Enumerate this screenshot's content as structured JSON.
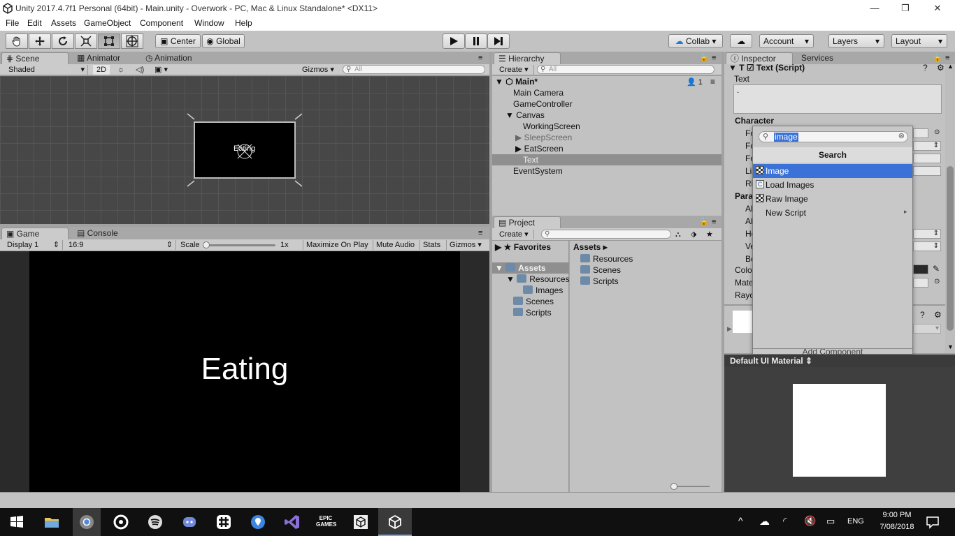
{
  "window": {
    "title": "Unity 2017.4.7f1 Personal (64bit) - Main.unity - Overwork - PC, Mac & Linux Standalone* <DX11>",
    "min_glyph": "—",
    "restore_glyph": "❐",
    "close_glyph": "✕"
  },
  "menu": [
    "File",
    "Edit",
    "Assets",
    "GameObject",
    "Component",
    "Window",
    "Help"
  ],
  "toolbar": {
    "pivot": "Center",
    "space": "Global",
    "collab": "Collab",
    "account": "Account",
    "layers": "Layers",
    "layout": "Layout"
  },
  "scene": {
    "tabs": [
      "Scene",
      "Animator",
      "Animation"
    ],
    "shading": "Shaded",
    "mode_2d": "2D",
    "gizmos": "Gizmos",
    "search_placeholder": "All",
    "canvas_text": "Eating"
  },
  "game": {
    "tabs": [
      "Game",
      "Console"
    ],
    "display": "Display 1",
    "aspect": "16:9",
    "scale_label": "Scale",
    "scale_value": "1x",
    "maximize": "Maximize On Play",
    "mute": "Mute Audio",
    "stats": "Stats",
    "gizmos": "Gizmos",
    "screen_text": "Eating"
  },
  "hierarchy": {
    "tab": "Hierarchy",
    "create": "Create",
    "search_placeholder": "All",
    "scene_name": "Main*",
    "scene_count": "1",
    "items": [
      "Main Camera",
      "GameController",
      "Canvas",
      "WorkingScreen",
      "SleepScreen",
      "EatScreen",
      "Text",
      "EventSystem"
    ]
  },
  "project": {
    "tab": "Project",
    "create": "Create",
    "favorites": "Favorites",
    "assets_root": "Assets",
    "tree": [
      "Resources",
      "Images",
      "Scenes",
      "Scripts"
    ],
    "breadcrumb": "Assets",
    "files": [
      "Resources",
      "Scenes",
      "Scripts"
    ]
  },
  "inspector": {
    "tabs": [
      "Inspector",
      "Services"
    ],
    "component": "Text (Script)",
    "text_label": "Text",
    "text_value": ".",
    "character_header": "Character",
    "paragraph_header": "Para",
    "truncated_labels": [
      "Fo",
      "Fo",
      "Fo",
      "Li",
      "Ri",
      "Al",
      "Al",
      "Ho",
      "Ve",
      "Be"
    ],
    "color_label": "Colo",
    "material_label": "Mate",
    "raycast_label": "Rayc",
    "add_component": "Add Component",
    "preview_title": "Default UI Material"
  },
  "add_component_popup": {
    "search_value": "image",
    "header": "Search",
    "items": [
      "Image",
      "Load Images",
      "Raw Image",
      "New Script"
    ]
  },
  "taskbar": {
    "language": "ENG",
    "time": "9:00 PM",
    "date": "7/08/2018"
  },
  "colors": {
    "selection": "#3a72d8",
    "editor_bg": "#c2c2c2",
    "scene_grid": "#474747",
    "game_black": "#000000"
  }
}
